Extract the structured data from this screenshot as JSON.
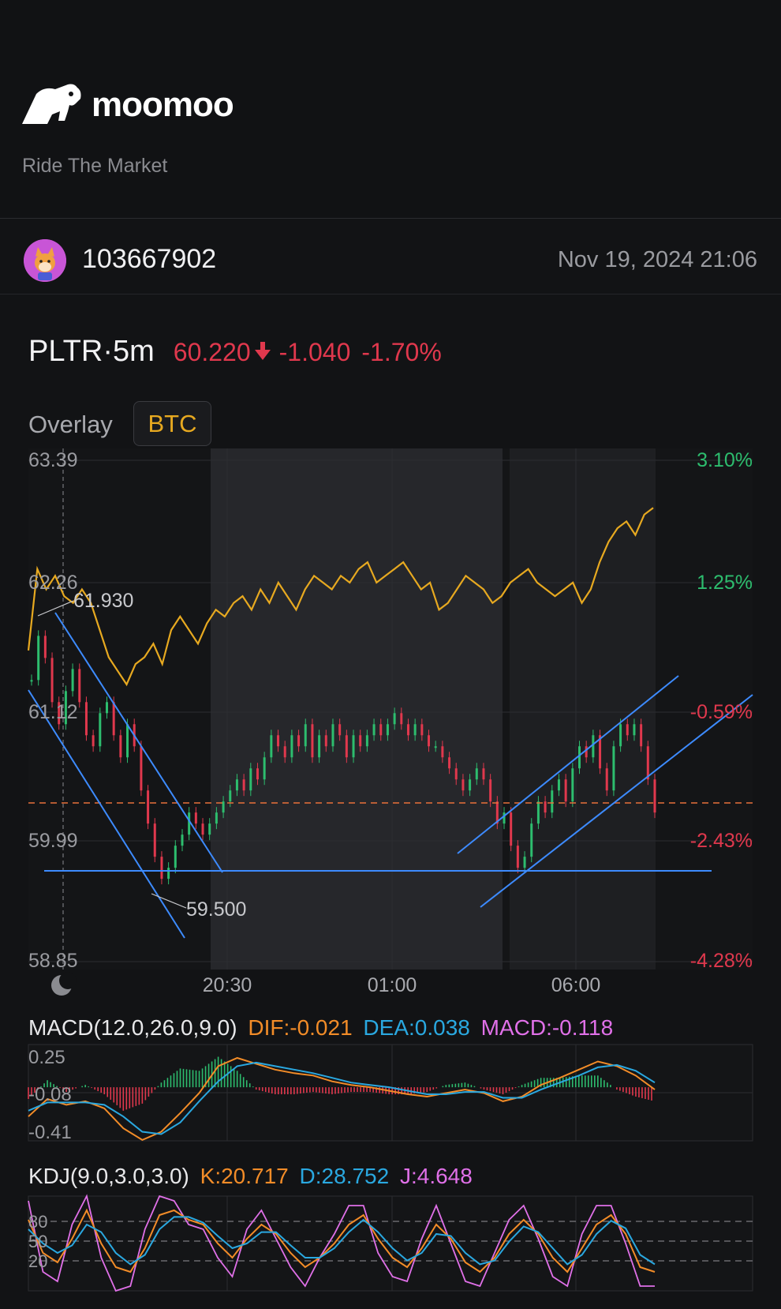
{
  "header": {
    "brand": "moomoo",
    "tagline": "Ride The Market"
  },
  "post": {
    "user_id": "103667902",
    "timestamp": "Nov 19, 2024 21:06"
  },
  "quote": {
    "symbol": "PLTR·5m",
    "price": "60.220",
    "change": "-1.040",
    "change_pct": "-1.70%",
    "down_color": "#e0384d",
    "up_color": "#2dbd6e"
  },
  "overlay": {
    "label": "Overlay",
    "symbol": "BTC",
    "color": "#e7a920"
  },
  "chart_data": [
    {
      "type": "candlestick",
      "left_axis_ticks": [
        "63.39",
        "62.26",
        "61.12",
        "59.99",
        "58.85"
      ],
      "right_axis_ticks": [
        "3.10%",
        "1.25%",
        "-0.59%",
        "-2.43%",
        "-4.28%"
      ],
      "time_ticks": [
        "20:30",
        "01:00",
        "06:00"
      ],
      "ylim": [
        58.85,
        63.39
      ],
      "annotations": {
        "high": "61.930",
        "low": "59.500"
      },
      "last_price": 60.22,
      "close_series": [
        61.4,
        61.8,
        61.6,
        61.2,
        61.0,
        61.3,
        61.5,
        61.2,
        60.9,
        60.8,
        61.1,
        61.2,
        60.9,
        60.7,
        61.0,
        60.8,
        60.4,
        60.1,
        59.8,
        59.6,
        59.7,
        59.9,
        60.0,
        60.2,
        60.1,
        60.0,
        60.1,
        60.2,
        60.3,
        60.4,
        60.5,
        60.4,
        60.6,
        60.5,
        60.7,
        60.9,
        60.8,
        60.7,
        60.9,
        60.8,
        61.0,
        60.7,
        60.9,
        60.8,
        61.0,
        60.9,
        60.7,
        60.9,
        60.8,
        60.9,
        61.0,
        60.9,
        61.0,
        61.1,
        61.0,
        60.9,
        61.0,
        60.9,
        60.8,
        60.8,
        60.7,
        60.6,
        60.5,
        60.4,
        60.5,
        60.6,
        60.5,
        60.3,
        60.1,
        60.2,
        59.9,
        59.7,
        59.8,
        60.1,
        60.3,
        60.2,
        60.4,
        60.5,
        60.3,
        60.6,
        60.8,
        60.7,
        60.9,
        60.6,
        60.4,
        60.8,
        61.0,
        60.9,
        61.0,
        60.8,
        60.5,
        60.2
      ],
      "btc_overlay_pct": [
        0.3,
        1.5,
        1.2,
        1.4,
        1.1,
        1.0,
        1.2,
        1.0,
        0.6,
        0.2,
        0.0,
        -0.2,
        0.1,
        0.2,
        0.4,
        0.1,
        0.6,
        0.8,
        0.6,
        0.4,
        0.7,
        0.9,
        0.8,
        1.0,
        1.1,
        0.9,
        1.2,
        1.0,
        1.3,
        1.1,
        0.9,
        1.2,
        1.4,
        1.3,
        1.2,
        1.4,
        1.3,
        1.5,
        1.6,
        1.3,
        1.4,
        1.5,
        1.6,
        1.4,
        1.2,
        1.3,
        0.9,
        1.0,
        1.2,
        1.4,
        1.3,
        1.2,
        1.0,
        1.1,
        1.3,
        1.4,
        1.5,
        1.3,
        1.2,
        1.1,
        1.2,
        1.3,
        1.0,
        1.2,
        1.6,
        1.9,
        2.1,
        2.2,
        2.0,
        2.3,
        2.4
      ],
      "trendlines": [
        "descending channel",
        "ascending channel",
        "support line"
      ]
    },
    {
      "type": "macd",
      "title": "MACD(12.0,26.0,9.0)",
      "dif": "DIF:-0.021",
      "dea": "DEA:0.038",
      "macd": "MACD:-0.118",
      "y_ticks": [
        "0.25",
        "-0.08",
        "-0.41"
      ],
      "ylim": [
        -0.41,
        0.25
      ],
      "dif_series": [
        -0.25,
        -0.1,
        -0.15,
        -0.12,
        -0.18,
        -0.35,
        -0.45,
        -0.38,
        -0.22,
        -0.05,
        0.18,
        0.25,
        0.2,
        0.15,
        0.12,
        0.1,
        0.05,
        0.02,
        0.0,
        -0.03,
        -0.06,
        -0.08,
        -0.05,
        -0.02,
        -0.05,
        -0.12,
        -0.08,
        0.02,
        0.08,
        0.15,
        0.22,
        0.18,
        0.1,
        -0.02
      ],
      "dea_series": [
        -0.2,
        -0.13,
        -0.13,
        -0.13,
        -0.15,
        -0.25,
        -0.38,
        -0.4,
        -0.3,
        -0.12,
        0.05,
        0.18,
        0.21,
        0.18,
        0.15,
        0.12,
        0.08,
        0.04,
        0.02,
        0.0,
        -0.03,
        -0.06,
        -0.06,
        -0.04,
        -0.04,
        -0.09,
        -0.09,
        -0.02,
        0.04,
        0.1,
        0.17,
        0.19,
        0.14,
        0.04
      ]
    },
    {
      "type": "kdj",
      "title": "KDJ(9.0,3.0,3.0)",
      "k": "K:20.717",
      "d": "D:28.752",
      "j": "J:4.648",
      "y_ticks": [
        "80",
        "50",
        "20"
      ],
      "ylim": [
        0,
        100
      ],
      "k_series": [
        75,
        40,
        30,
        55,
        85,
        50,
        25,
        20,
        45,
        80,
        85,
        75,
        70,
        50,
        35,
        55,
        70,
        60,
        40,
        25,
        35,
        50,
        70,
        80,
        55,
        35,
        25,
        45,
        70,
        55,
        30,
        20,
        35,
        60,
        75,
        60,
        35,
        20,
        45,
        70,
        80,
        60,
        25,
        20
      ],
      "d_series": [
        65,
        50,
        40,
        48,
        70,
        62,
        40,
        28,
        38,
        65,
        78,
        78,
        72,
        58,
        45,
        50,
        62,
        62,
        48,
        35,
        35,
        45,
        62,
        75,
        62,
        45,
        32,
        40,
        60,
        58,
        40,
        28,
        32,
        52,
        68,
        62,
        45,
        28,
        38,
        60,
        74,
        66,
        38,
        28
      ],
      "j_series": [
        95,
        20,
        10,
        70,
        105,
        35,
        0,
        5,
        65,
        100,
        95,
        70,
        65,
        35,
        15,
        65,
        85,
        55,
        25,
        5,
        35,
        60,
        90,
        90,
        40,
        15,
        10,
        55,
        90,
        50,
        10,
        5,
        40,
        75,
        90,
        55,
        15,
        5,
        60,
        90,
        90,
        50,
        5,
        5
      ]
    }
  ]
}
